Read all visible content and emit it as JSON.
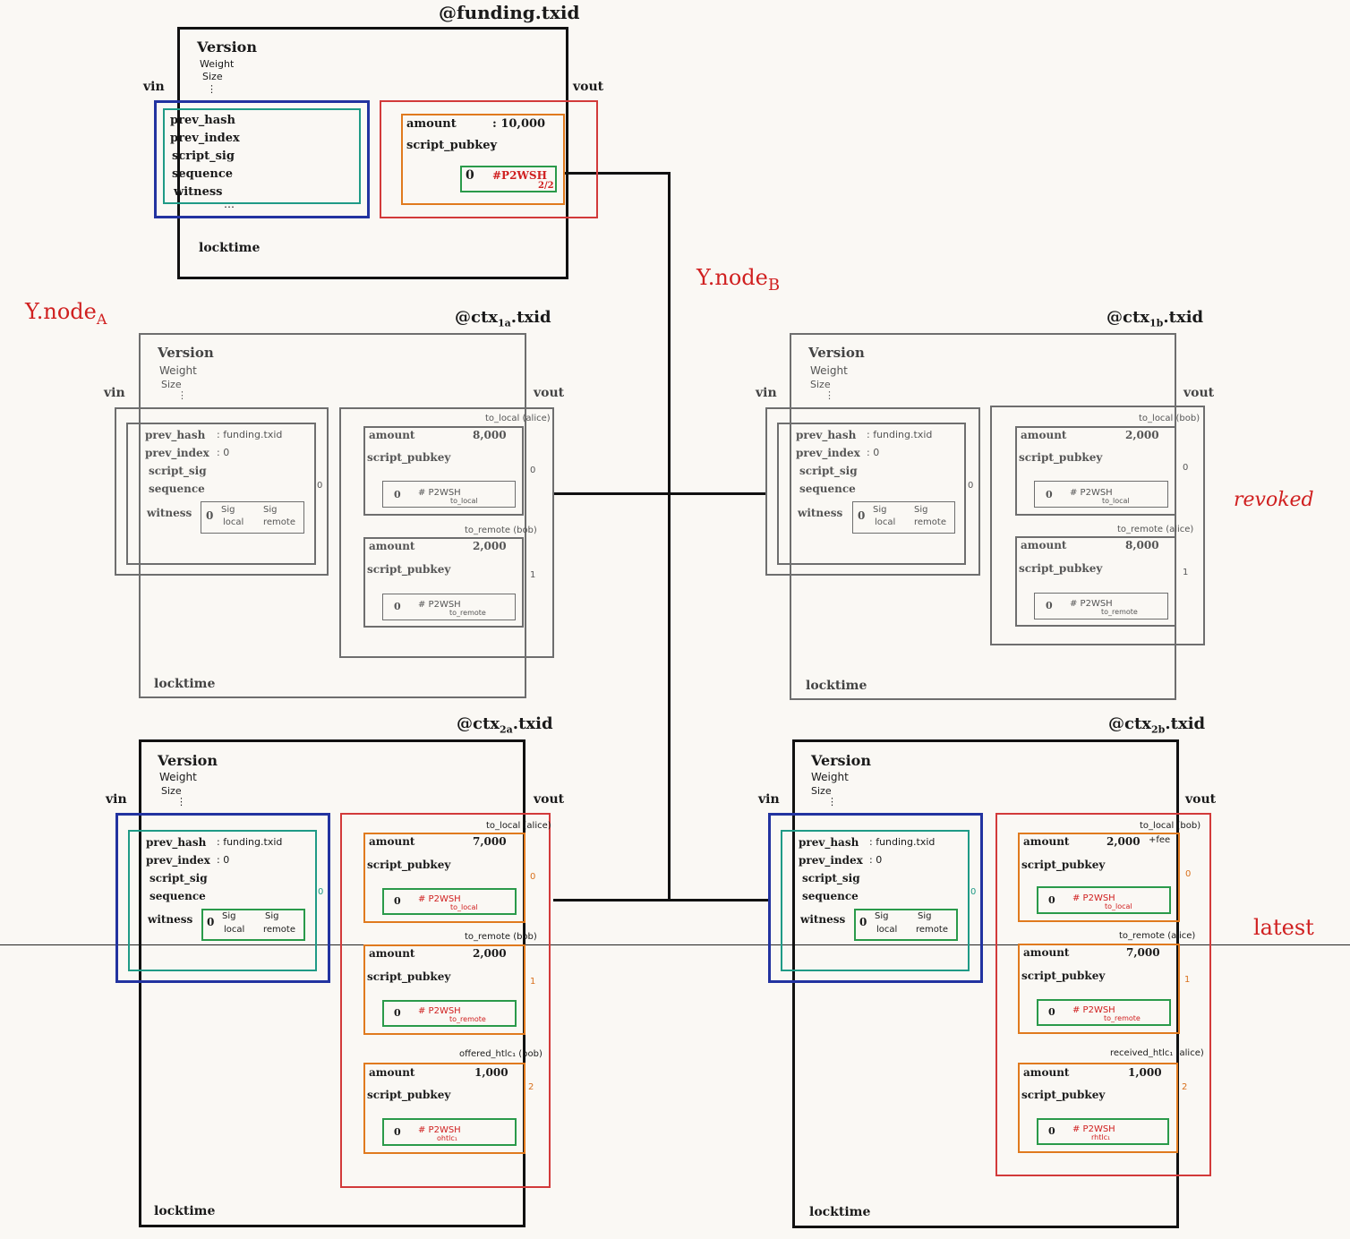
{
  "labels": {
    "version": "Version",
    "weight": "Weight",
    "size": "Size",
    "ellipsis": "⋮",
    "vin": "vin",
    "vout": "vout",
    "locktime": "locktime",
    "prev_hash": "prev_hash",
    "prev_index": "prev_index",
    "script_sig": "script_sig",
    "sequence": "sequence",
    "witness": "witness",
    "amount": "amount",
    "script_pubkey": "script_pubkey",
    "zero": "0",
    "sig": "Sig",
    "local": "local",
    "remote": "remote",
    "dots": "…"
  },
  "annotations": {
    "node_a": "Y.node",
    "node_a_sub": "A",
    "node_b": "Y.node",
    "node_b_sub": "B",
    "revoked": "revoked",
    "latest": "latest"
  },
  "funding": {
    "title": "@funding.txid",
    "amount": ": 10,000",
    "colon": ":",
    "script": "#P2WSH",
    "script_sub": "2/2"
  },
  "ctx1a": {
    "title_pre": "@ctx",
    "title_sub": "1a",
    "title_post": ".txid",
    "prev_hash": ": funding.txid",
    "prev_index": ": 0",
    "vin_index": "0",
    "outputs": [
      {
        "label": "to_local (alice)",
        "amount": "8,000",
        "index": "0",
        "script": "# P2WSH",
        "script_sub": "to_local"
      },
      {
        "label": "to_remote (bob)",
        "amount": "2,000",
        "index": "1",
        "script": "# P2WSH",
        "script_sub": "to_remote"
      }
    ]
  },
  "ctx1b": {
    "title_pre": "@ctx",
    "title_sub": "1b",
    "title_post": ".txid",
    "prev_hash": ": funding.txid",
    "prev_index": ": 0",
    "vin_index": "0",
    "outputs": [
      {
        "label": "to_local (bob)",
        "amount": "2,000",
        "index": "0",
        "script": "# P2WSH",
        "script_sub": "to_local"
      },
      {
        "label": "to_remote (alice)",
        "amount": "8,000",
        "index": "1",
        "script": "# P2WSH",
        "script_sub": "to_remote"
      }
    ]
  },
  "ctx2a": {
    "title_pre": "@ctx",
    "title_sub": "2a",
    "title_post": ".txid",
    "prev_hash": ": funding.txid",
    "prev_index": ": 0",
    "vin_index": "0",
    "outputs": [
      {
        "label": "to_local (alice)",
        "amount": "7,000",
        "index": "0",
        "script": "# P2WSH",
        "script_sub": "to_local"
      },
      {
        "label": "to_remote (bob)",
        "amount": "2,000",
        "index": "1",
        "script": "# P2WSH",
        "script_sub": "to_remote"
      },
      {
        "label": "offered_htlc₁ (bob)",
        "amount": "1,000",
        "index": "2",
        "script": "# P2WSH",
        "script_sub": "ohtlc₁"
      }
    ]
  },
  "ctx2b": {
    "title_pre": "@ctx",
    "title_sub": "2b",
    "title_post": ".txid",
    "prev_hash": ": funding.txid",
    "prev_index": ": 0",
    "vin_index": "0",
    "outputs": [
      {
        "label": "to_local (bob)",
        "amount": "2,000",
        "amount_extra": "+fee",
        "index": "0",
        "script": "# P2WSH",
        "script_sub": "to_local"
      },
      {
        "label": "to_remote (alice)",
        "amount": "7,000",
        "index": "1",
        "script": "# P2WSH",
        "script_sub": "to_remote"
      },
      {
        "label": "received_htlc₁ (alice)",
        "amount": "1,000",
        "index": "2",
        "script": "# P2WSH",
        "script_sub": "rhtlc₁"
      }
    ]
  },
  "colors": {
    "background": "#faf8f4",
    "ink": "#111111",
    "gray": "#6e6e6e",
    "blue": "#2233a0",
    "teal": "#1f9a86",
    "red": "#d23a3a",
    "orange": "#e07a1e",
    "green": "#2a9a4a",
    "annotation_red": "#d02020"
  }
}
